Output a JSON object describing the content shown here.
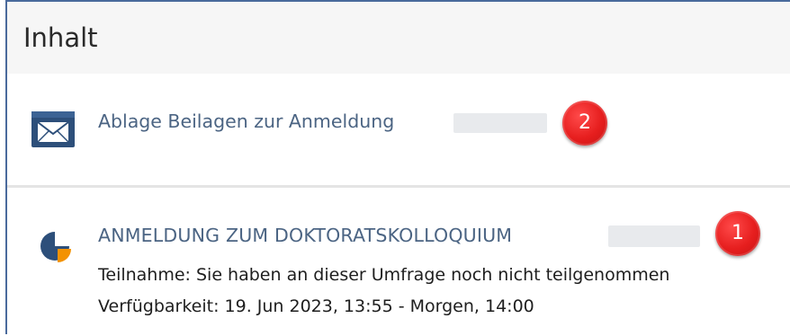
{
  "header": {
    "title": "Inhalt"
  },
  "items": [
    {
      "icon": "mail-icon",
      "title": "Ablage Beilagen zur Anmeldung",
      "annotation": "2"
    },
    {
      "icon": "survey-pie-icon",
      "title": "ANMELDUNG ZUM DOKTORATSKOLLOQUIUM",
      "annotation": "1",
      "properties": [
        "Teilnahme: Sie haben an dieser Umfrage noch nicht teilgenommen",
        "Verfügbarkeit: 19. Jun 2023, 13:55 - Morgen, 14:00"
      ]
    }
  ],
  "colors": {
    "frame_border": "#4a6a9c",
    "header_bg": "#f6f6f6",
    "link": "#4b6483",
    "badge": "#e61e1e",
    "survey_accent": "#f39200",
    "icon_dark": "#2d4f7a"
  }
}
